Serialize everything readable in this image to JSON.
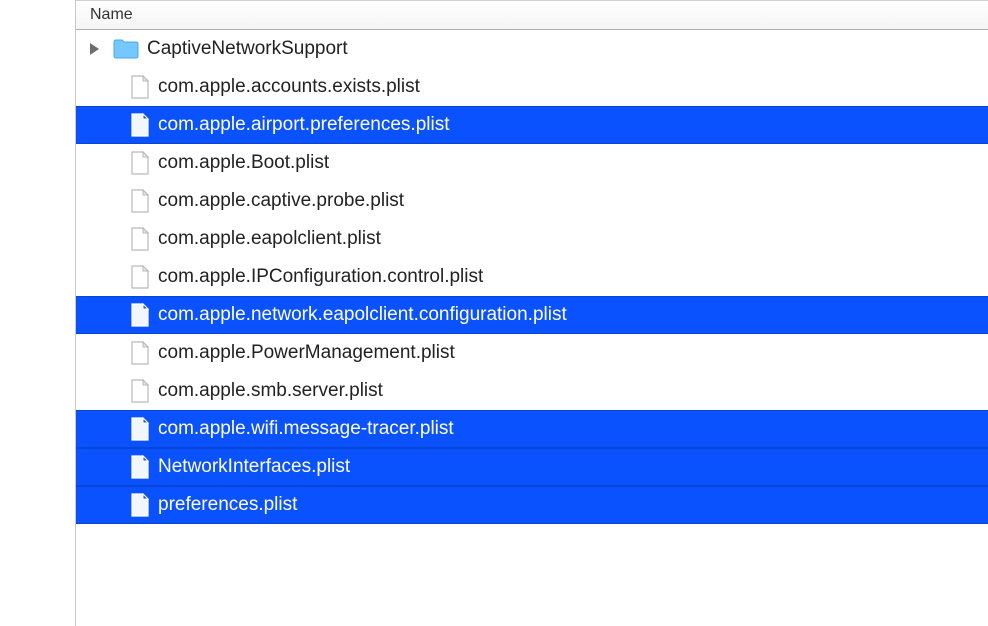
{
  "header": {
    "name_column": "Name"
  },
  "colors": {
    "selection": "#0b52ff",
    "folder": "#6fc7ff",
    "folder_tab": "#4aa9e8"
  },
  "rows": [
    {
      "type": "folder",
      "name": "CaptiveNetworkSupport",
      "selected": false,
      "expandable": true,
      "indent": 0
    },
    {
      "type": "file",
      "name": "com.apple.accounts.exists.plist",
      "selected": false,
      "indent": 1
    },
    {
      "type": "file",
      "name": "com.apple.airport.preferences.plist",
      "selected": true,
      "indent": 1
    },
    {
      "type": "file",
      "name": "com.apple.Boot.plist",
      "selected": false,
      "indent": 1
    },
    {
      "type": "file",
      "name": "com.apple.captive.probe.plist",
      "selected": false,
      "indent": 1
    },
    {
      "type": "file",
      "name": "com.apple.eapolclient.plist",
      "selected": false,
      "indent": 1
    },
    {
      "type": "file",
      "name": "com.apple.IPConfiguration.control.plist",
      "selected": false,
      "indent": 1
    },
    {
      "type": "file",
      "name": "com.apple.network.eapolclient.configuration.plist",
      "selected": true,
      "indent": 1
    },
    {
      "type": "file",
      "name": "com.apple.PowerManagement.plist",
      "selected": false,
      "indent": 1
    },
    {
      "type": "file",
      "name": "com.apple.smb.server.plist",
      "selected": false,
      "indent": 1
    },
    {
      "type": "file",
      "name": "com.apple.wifi.message-tracer.plist",
      "selected": true,
      "indent": 1
    },
    {
      "type": "file",
      "name": "NetworkInterfaces.plist",
      "selected": true,
      "indent": 1
    },
    {
      "type": "file",
      "name": "preferences.plist",
      "selected": true,
      "indent": 1
    }
  ]
}
